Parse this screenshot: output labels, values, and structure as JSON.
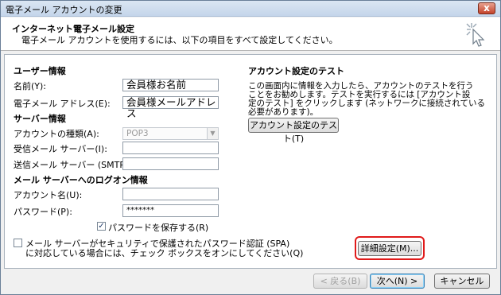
{
  "window": {
    "title": "電子メール アカウントの変更",
    "close_glyph": "x"
  },
  "header": {
    "title": "インターネット電子メール設定",
    "subtitle": "電子メール アカウントを使用するには、以下の項目をすべて設定してください。"
  },
  "user_info": {
    "heading": "ユーザー情報",
    "name_label": "名前(Y):",
    "name_value": "会員様お名前",
    "email_label": "電子メール アドレス(E):",
    "email_value": "会員様メールアドレス"
  },
  "server_info": {
    "heading": "サーバー情報",
    "account_type_label": "アカウントの種類(A):",
    "account_type_value": "POP3",
    "incoming_label": "受信メール サーバー(I):",
    "incoming_value": "",
    "outgoing_label": "送信メール サーバー (SMTP)(O):",
    "outgoing_value": ""
  },
  "logon_info": {
    "heading": "メール サーバーへのログオン情報",
    "account_name_label": "アカウント名(U):",
    "account_name_value": "",
    "password_label": "パスワード(P):",
    "password_value": "*******",
    "save_password_label": "パスワードを保存する(R)",
    "save_password_checked": true,
    "spa_label_line1": "メール サーバーがセキュリティで保護されたパスワード認証 (SPA)",
    "spa_label_line2": "に対応している場合には、チェック ボックスをオンにしてください(Q)",
    "spa_checked": false
  },
  "test": {
    "heading": "アカウント設定のテスト",
    "desc_line1": "この画面内に情報を入力したら、アカウントのテストを行う",
    "desc_line2": "ことをお勧めします。テストを実行するには [アカウント設",
    "desc_line3": "定のテスト] をクリックします (ネットワークに接続されている",
    "desc_line4": "必要があります)。",
    "test_button": "アカウント設定のテスト(T)"
  },
  "buttons": {
    "advanced": "詳細設定(M)...",
    "back": "< 戻る(B)",
    "next": "次へ(N) >",
    "cancel": "キャンセル"
  },
  "colors": {
    "highlight": "#e01a1a",
    "title_bg": "#c4d5ea"
  },
  "icons": {
    "header_icon": "cursor-sparkle-icon",
    "dropdown": "chevron-down-icon",
    "check": "checkmark-icon"
  }
}
